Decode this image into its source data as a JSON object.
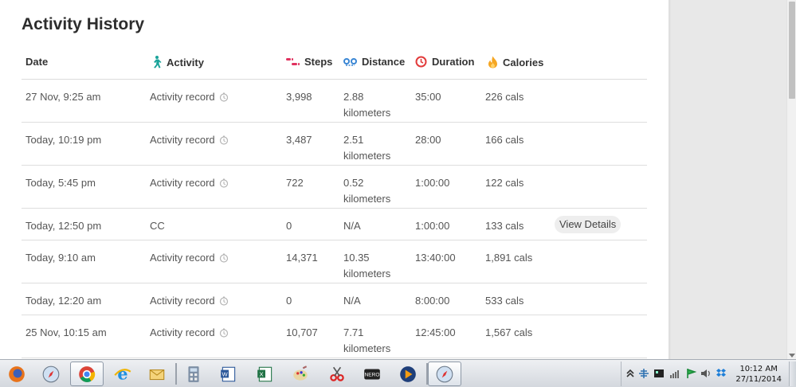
{
  "title": "Activity History",
  "columns": {
    "date": "Date",
    "activity": "Activity",
    "steps": "Steps",
    "distance": "Distance",
    "duration": "Duration",
    "calories": "Calories"
  },
  "header_icons": {
    "activity": "walking-person-icon",
    "steps": "footprints-icon",
    "distance": "location-pins-icon",
    "duration": "clock-icon",
    "calories": "flame-icon"
  },
  "rows": [
    {
      "date": "27 Nov, 9:25 am",
      "activity": "Activity record",
      "timer": true,
      "steps": "3,998",
      "distance": "2.88 kilometers",
      "duration": "35:00",
      "calories": "226 cals"
    },
    {
      "date": "Today, 10:19 pm",
      "activity": "Activity record",
      "timer": true,
      "steps": "3,487",
      "distance": "2.51 kilometers",
      "duration": "28:00",
      "calories": "166 cals"
    },
    {
      "date": "Today, 5:45 pm",
      "activity": "Activity record",
      "timer": true,
      "steps": "722",
      "distance": "0.52 kilometers",
      "duration": "1:00:00",
      "calories": "122 cals"
    },
    {
      "date": "Today, 12:50 pm",
      "activity": "CC",
      "timer": false,
      "steps": "0",
      "distance": "N/A",
      "duration": "1:00:00",
      "calories": "133 cals",
      "action": "View Details"
    },
    {
      "date": "Today, 9:10 am",
      "activity": "Activity record",
      "timer": true,
      "steps": "14,371",
      "distance": "10.35 kilometers",
      "duration": "13:40:00",
      "calories": "1,891 cals"
    },
    {
      "date": "Today, 12:20 am",
      "activity": "Activity record",
      "timer": true,
      "steps": "0",
      "distance": "N/A",
      "duration": "8:00:00",
      "calories": "533 cals"
    },
    {
      "date": "25 Nov, 10:15 am",
      "activity": "Activity record",
      "timer": true,
      "steps": "10,707",
      "distance": "7.71 kilometers",
      "duration": "12:45:00",
      "calories": "1,567 cals"
    }
  ],
  "colors": {
    "activity_icon": "#1aa39a",
    "steps_icon": "#e0315e",
    "distance_icon": "#3a86d4",
    "duration_icon": "#e23b3b",
    "calories_icon": "#f5a623"
  },
  "taskbar": {
    "apps": [
      "firefox-icon",
      "safari-icon",
      "chrome-icon",
      "internet-explorer-icon",
      "mail-icon",
      "calculator-icon",
      "word-icon",
      "excel-icon",
      "paint-icon",
      "snipping-tool-icon",
      "nero-icon",
      "media-player-icon",
      "safari-icon"
    ],
    "clock_time": "10:12 AM",
    "clock_date": "27/11/2014"
  }
}
